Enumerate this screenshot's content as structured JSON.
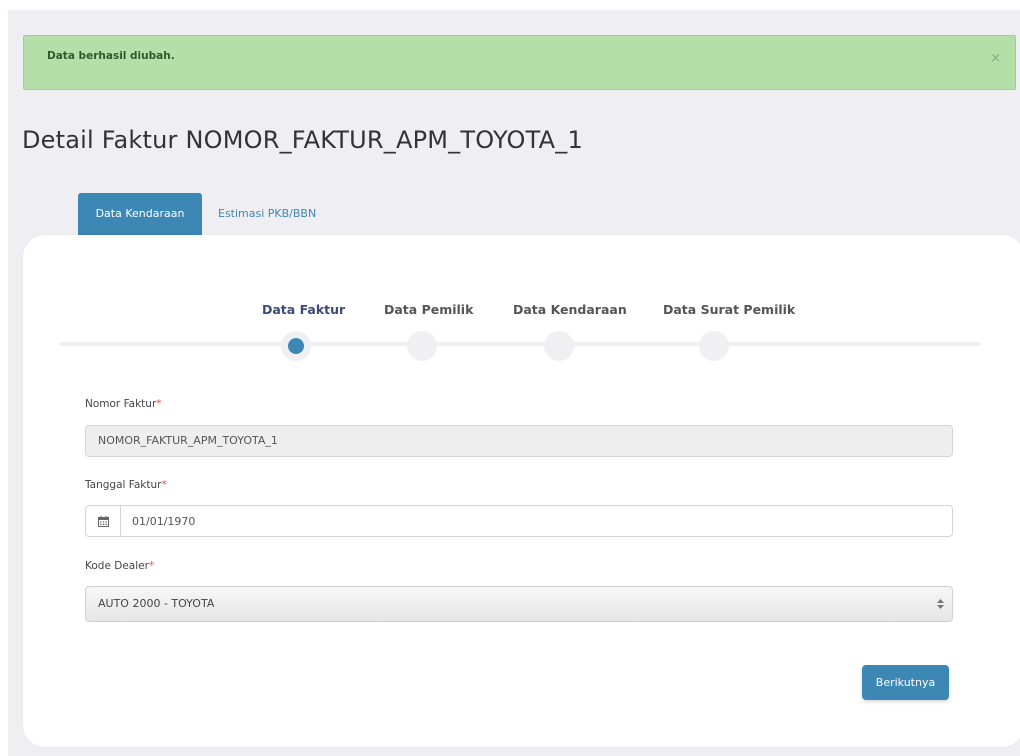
{
  "alert": {
    "message": "Data berhasil diubah.",
    "close_glyph": "×"
  },
  "page": {
    "title": "Detail Faktur NOMOR_FAKTUR_APM_TOYOTA_1"
  },
  "tabs": [
    {
      "label": "Data Kendaraan",
      "active": true
    },
    {
      "label": "Estimasi PKB/BBN",
      "active": false
    }
  ],
  "steps": [
    {
      "label": "Data Faktur",
      "active": true
    },
    {
      "label": "Data Pemilik",
      "active": false
    },
    {
      "label": "Data Kendaraan",
      "active": false
    },
    {
      "label": "Data Surat Pemilik",
      "active": false
    }
  ],
  "form": {
    "nomor_faktur": {
      "label": "Nomor Faktur",
      "required_mark": "*",
      "value": "NOMOR_FAKTUR_APM_TOYOTA_1"
    },
    "tanggal_faktur": {
      "label": "Tanggal Faktur",
      "required_mark": "*",
      "value": "01/01/1970",
      "icon": "calendar-icon"
    },
    "kode_dealer": {
      "label": "Kode Dealer",
      "required_mark": "*",
      "selected": "AUTO 2000 - TOYOTA"
    }
  },
  "actions": {
    "next_label": "Berikutnya"
  },
  "colors": {
    "accent": "#3c87b4",
    "alert_bg": "#b5dfa9",
    "required": "#d9534f",
    "background": "#efeff3"
  }
}
